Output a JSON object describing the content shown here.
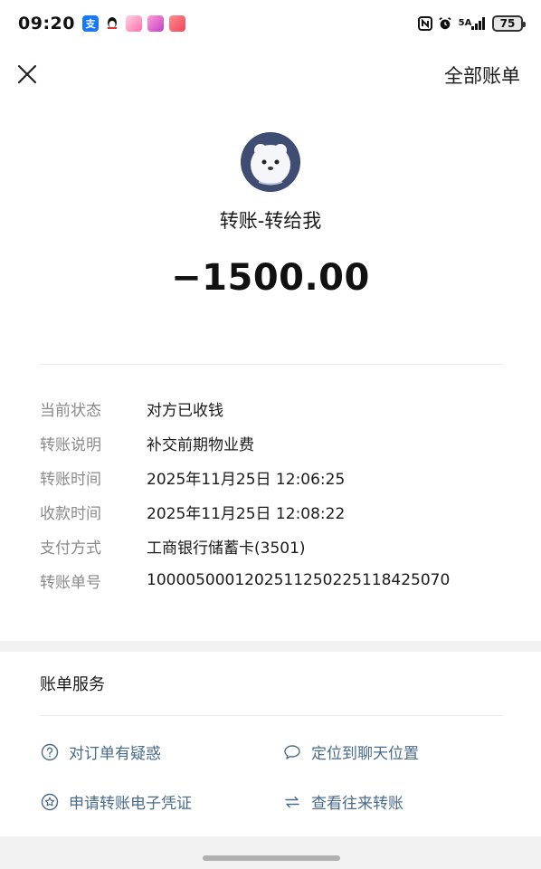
{
  "status_bar": {
    "time": "09:20",
    "apps": [
      {
        "name": "alipay-icon",
        "glyph": "支",
        "color": "#1677ff"
      },
      {
        "name": "qq-icon",
        "glyph": "🐧",
        "color": "#ffffff"
      },
      {
        "name": "app-icon-pink",
        "glyph": "",
        "color": "#ff6fa8"
      },
      {
        "name": "app-icon-purple",
        "glyph": "",
        "color": "#c043c8"
      },
      {
        "name": "app-icon-red",
        "glyph": "",
        "color": "#f0455a"
      }
    ],
    "signal_text": "5A",
    "battery": "75"
  },
  "nav": {
    "all_bills_label": "全部账单"
  },
  "transaction": {
    "title": "转账-转给我",
    "amount": "−1500.00"
  },
  "details": [
    {
      "label": "当前状态",
      "value": "对方已收钱"
    },
    {
      "label": "转账说明",
      "value": "补交前期物业费"
    },
    {
      "label": "转账时间",
      "value": "2025年11月25日 12:06:25"
    },
    {
      "label": "收款时间",
      "value": "2025年11月25日 12:08:22"
    },
    {
      "label": "支付方式",
      "value": "工商银行储蓄卡(3501)"
    },
    {
      "label": "转账单号",
      "value": "100005000120251125022511842507​0"
    }
  ],
  "services": {
    "title": "账单服务",
    "items": [
      {
        "label": "对订单有疑惑",
        "icon": "question-circle-icon"
      },
      {
        "label": "定位到聊天位置",
        "icon": "chat-bubble-icon"
      },
      {
        "label": "申请转账电子凭证",
        "icon": "star-circle-icon"
      },
      {
        "label": "查看往来转账",
        "icon": "swap-arrows-icon"
      }
    ]
  },
  "colors": {
    "link": "#4a6b8a",
    "label_gray": "#8a8a8a",
    "section_gap": "#f2f2f2"
  }
}
